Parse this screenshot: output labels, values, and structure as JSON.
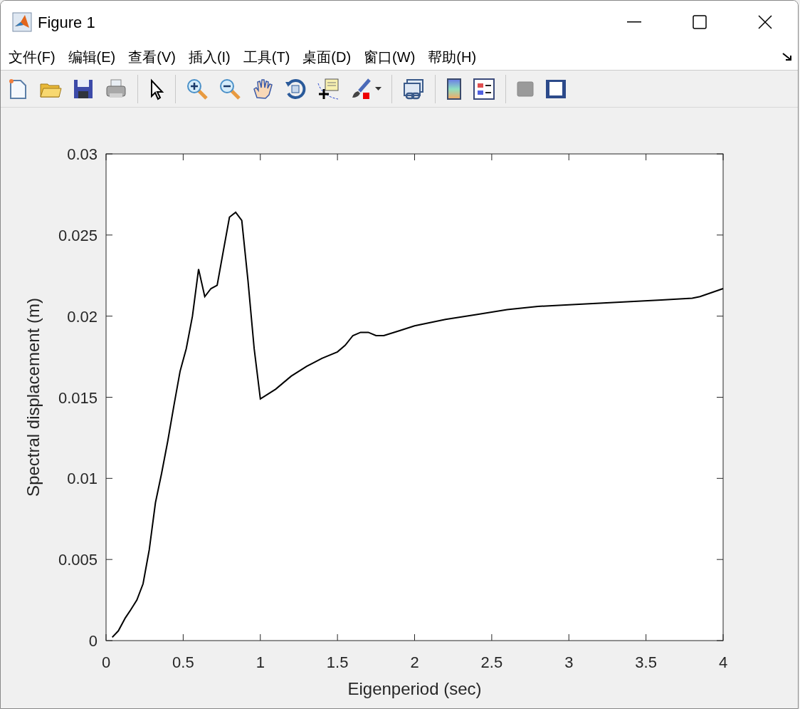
{
  "window": {
    "title": "Figure 1"
  },
  "menu": [
    {
      "label": "文件(F)"
    },
    {
      "label": "编辑(E)"
    },
    {
      "label": "查看(V)"
    },
    {
      "label": "插入(I)"
    },
    {
      "label": "工具(T)"
    },
    {
      "label": "桌面(D)"
    },
    {
      "label": "窗口(W)"
    },
    {
      "label": "帮助(H)"
    }
  ],
  "figure": {
    "chart_data": {
      "type": "line",
      "xlabel": "Eigenperiod (sec)",
      "ylabel": "Spectral displacement (m)",
      "xlim": [
        0,
        4
      ],
      "ylim": [
        0,
        0.03
      ],
      "xticks": [
        0,
        0.5,
        1,
        1.5,
        2,
        2.5,
        3,
        3.5,
        4
      ],
      "yticks": [
        0,
        0.005,
        0.01,
        0.015,
        0.02,
        0.025,
        0.03
      ],
      "x": [
        0.04,
        0.08,
        0.125,
        0.16,
        0.2,
        0.24,
        0.28,
        0.32,
        0.36,
        0.4,
        0.44,
        0.48,
        0.52,
        0.56,
        0.6,
        0.64,
        0.68,
        0.72,
        0.76,
        0.8,
        0.84,
        0.88,
        0.92,
        0.96,
        1.0,
        1.1,
        1.2,
        1.3,
        1.4,
        1.5,
        1.55,
        1.6,
        1.65,
        1.7,
        1.75,
        1.8,
        1.9,
        2.0,
        2.2,
        2.4,
        2.6,
        2.8,
        3.0,
        3.2,
        3.4,
        3.6,
        3.8,
        3.85,
        4.0
      ],
      "series": [
        {
          "color": "#000000",
          "values": [
            0.0002,
            0.0006,
            0.0014,
            0.0019,
            0.0025,
            0.0035,
            0.0056,
            0.0085,
            0.0103,
            0.0123,
            0.0145,
            0.0166,
            0.018,
            0.02,
            0.0229,
            0.0212,
            0.0217,
            0.0219,
            0.024,
            0.0261,
            0.0264,
            0.0259,
            0.0222,
            0.018,
            0.0149,
            0.0155,
            0.0163,
            0.0169,
            0.0174,
            0.0178,
            0.0182,
            0.0188,
            0.019,
            0.019,
            0.0188,
            0.0188,
            0.0191,
            0.0194,
            0.0198,
            0.0201,
            0.0204,
            0.0206,
            0.0207,
            0.0208,
            0.0209,
            0.021,
            0.0211,
            0.0212,
            0.0217
          ]
        }
      ]
    }
  }
}
